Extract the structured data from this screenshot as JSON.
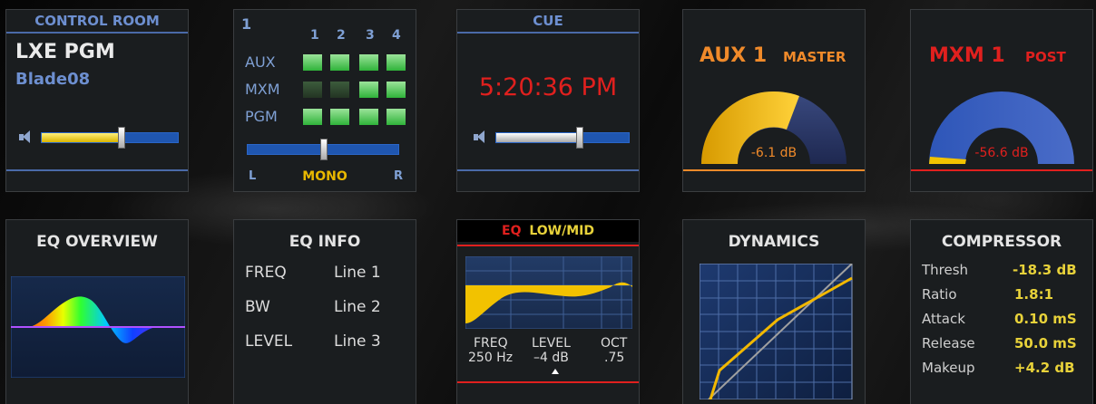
{
  "control_room": {
    "header": "CONTROL ROOM",
    "source": "LXE PGM",
    "device": "Blade08",
    "fader_level": 0.58
  },
  "routing": {
    "bus_number": "1",
    "columns": [
      "1",
      "2",
      "3",
      "4"
    ],
    "rows": [
      {
        "label": "AUX",
        "states": [
          true,
          true,
          true,
          true
        ]
      },
      {
        "label": "MXM",
        "states": [
          false,
          false,
          true,
          true
        ]
      },
      {
        "label": "PGM",
        "states": [
          true,
          true,
          true,
          true
        ]
      }
    ],
    "pan_left": "L",
    "pan_mode": "MONO",
    "pan_right": "R",
    "pan_position": 0.5
  },
  "cue": {
    "header": "CUE",
    "time": "5:20:36 PM",
    "fader_level": 0.62
  },
  "aux_meter": {
    "name": "AUX 1",
    "tag": "MASTER",
    "value": "-6.1 dB",
    "level": 0.53
  },
  "mxm_meter": {
    "name": "MXM 1",
    "tag": "POST",
    "value": "-56.6 dB",
    "level": 0.03
  },
  "eq_overview": {
    "title": "EQ OVERVIEW"
  },
  "eq_info": {
    "title": "EQ INFO",
    "rows": [
      {
        "label": "FREQ",
        "value": "Line 1"
      },
      {
        "label": "BW",
        "value": "Line 2"
      },
      {
        "label": "LEVEL",
        "value": "Line 3"
      }
    ]
  },
  "eq_band": {
    "tag": "EQ",
    "band": "LOW/MID",
    "params": [
      {
        "label": "FREQ",
        "value": "250 Hz"
      },
      {
        "label": "LEVEL",
        "value": "–4 dB"
      },
      {
        "label": "OCT",
        "value": ".75"
      }
    ]
  },
  "dynamics": {
    "title": "DYNAMICS"
  },
  "compressor": {
    "title": "COMPRESSOR",
    "rows": [
      {
        "label": "Thresh",
        "value": "-18.3 dB"
      },
      {
        "label": "Ratio",
        "value": "1.8:1"
      },
      {
        "label": "Attack",
        "value": "0.10 mS"
      },
      {
        "label": "Release",
        "value": "50.0 mS"
      },
      {
        "label": "Makeup",
        "value": "+4.2 dB"
      }
    ]
  },
  "colors": {
    "accent_blue": "#6d8fd0",
    "orange": "#f08a2a",
    "red": "#e0201e",
    "yellow": "#e8d23a",
    "green": "#3fbf46"
  }
}
